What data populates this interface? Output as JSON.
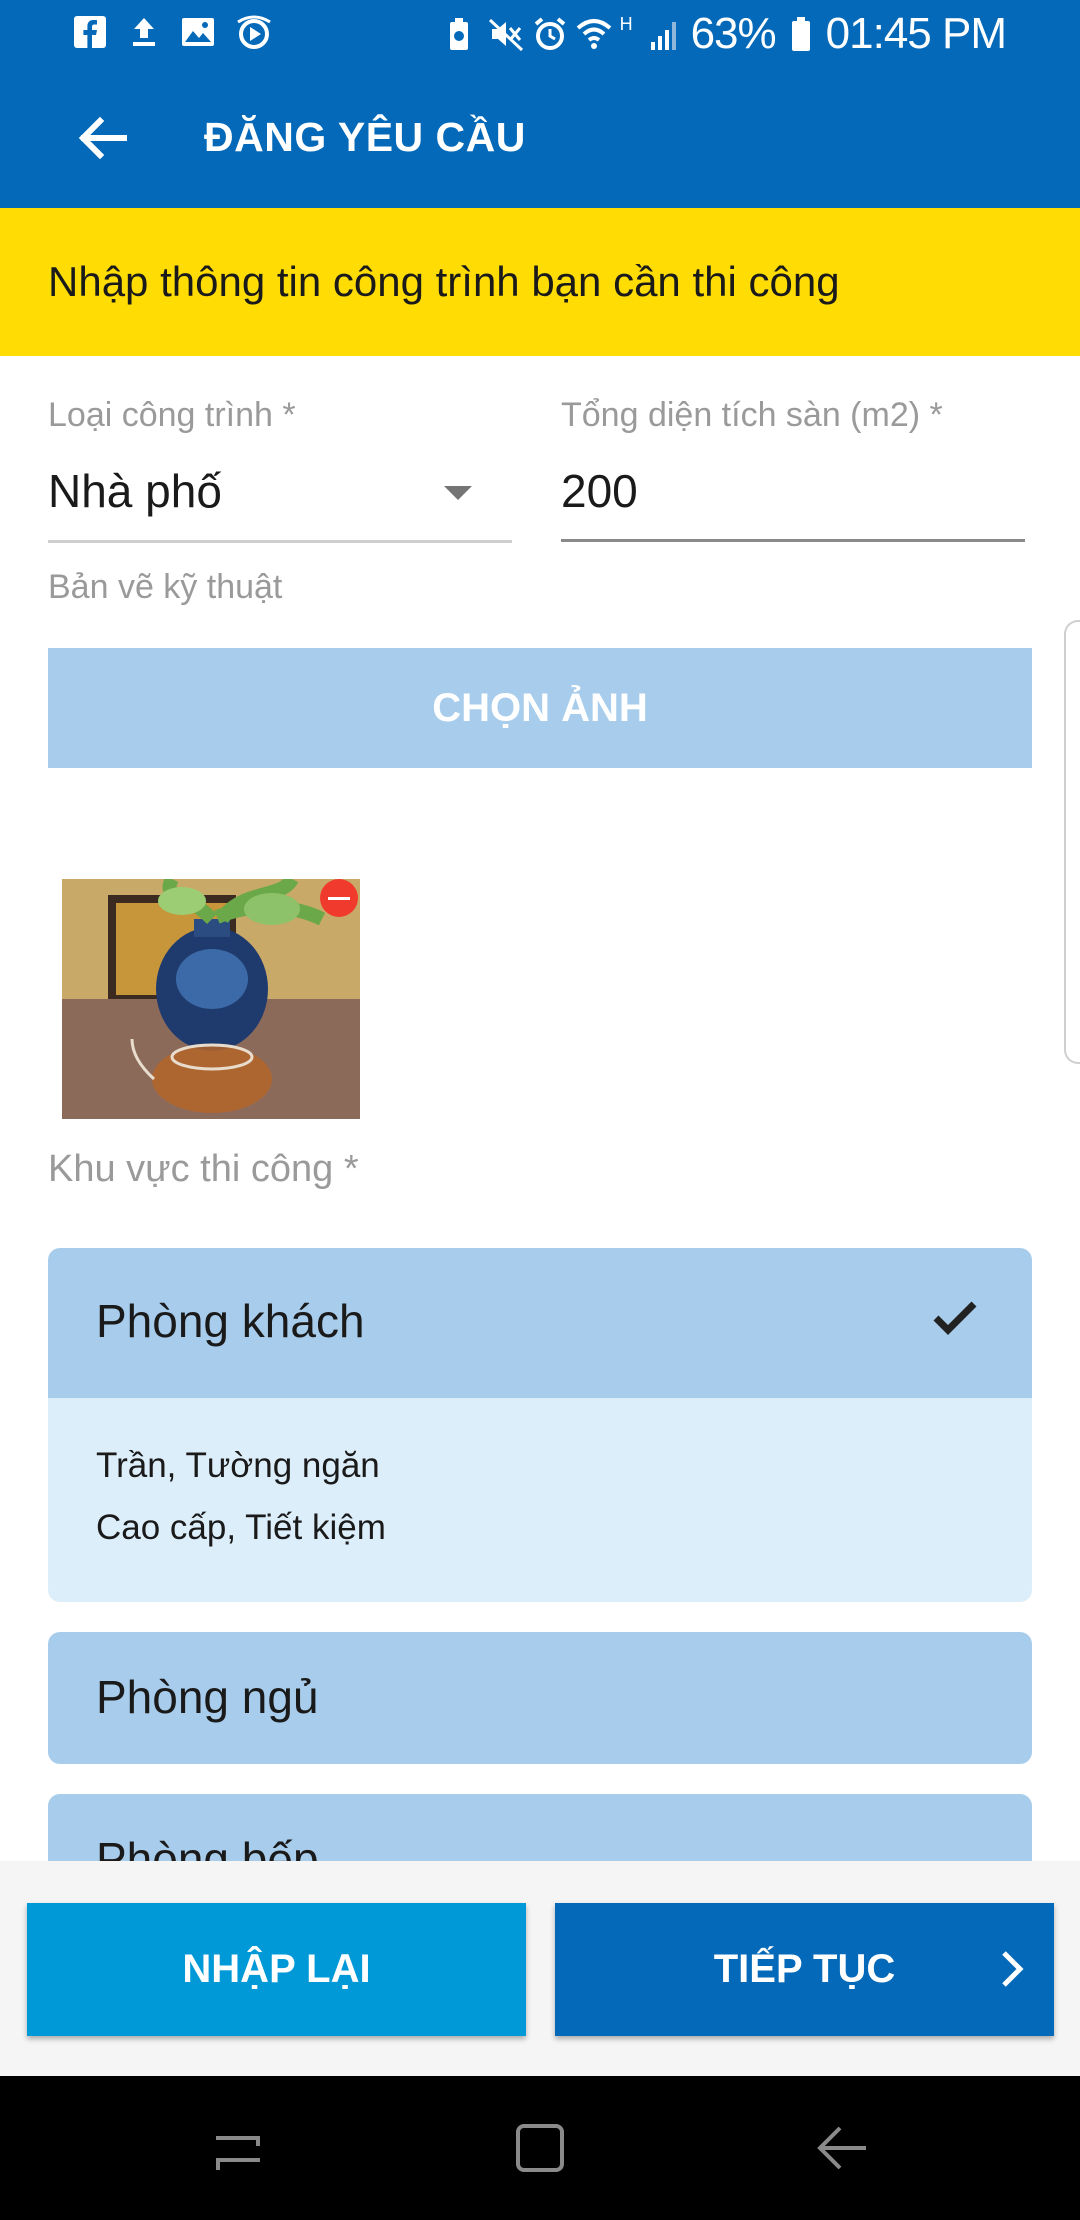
{
  "status_bar": {
    "battery": "63%",
    "time": "01:45 PM",
    "network": "H",
    "icons_left": [
      "facebook-icon",
      "upload-icon",
      "image-icon",
      "media-icon"
    ],
    "icons_right": [
      "battery-saver-icon",
      "mute-icon",
      "alarm-icon",
      "wifi-icon",
      "signal-icon",
      "battery-icon"
    ]
  },
  "app_bar": {
    "title": "ĐĂNG YÊU CẦU",
    "back_icon": "arrow-left-icon"
  },
  "banner": {
    "text": "Nhập thông tin công trình bạn cần thi công"
  },
  "form": {
    "project_type": {
      "label": "Loại công trình *",
      "value": "Nhà phố"
    },
    "floor_area": {
      "label": "Tổng diện tích sàn (m2) *",
      "value": "200"
    },
    "drawings": {
      "label": "Bản vẽ kỹ thuật",
      "button": "CHỌN ẢNH"
    },
    "area_section": {
      "label": "Khu vực thi công *"
    },
    "areas": [
      {
        "title": "Phòng khách",
        "selected": true,
        "details": [
          "Trần, Tường ngăn",
          "Cao cấp, Tiết kiệm"
        ]
      },
      {
        "title": "Phòng ngủ",
        "selected": false
      },
      {
        "title": "Phòng bếp",
        "selected": false
      }
    ]
  },
  "actions": {
    "reset_label": "NHẬP LẠI",
    "next_label": "TIẾP TỤC"
  },
  "colors": {
    "primary": "#0369b8",
    "banner": "#fedc04",
    "card_header": "#a8cdec",
    "card_body": "#ddeefb",
    "reset_button": "#0099d8"
  }
}
